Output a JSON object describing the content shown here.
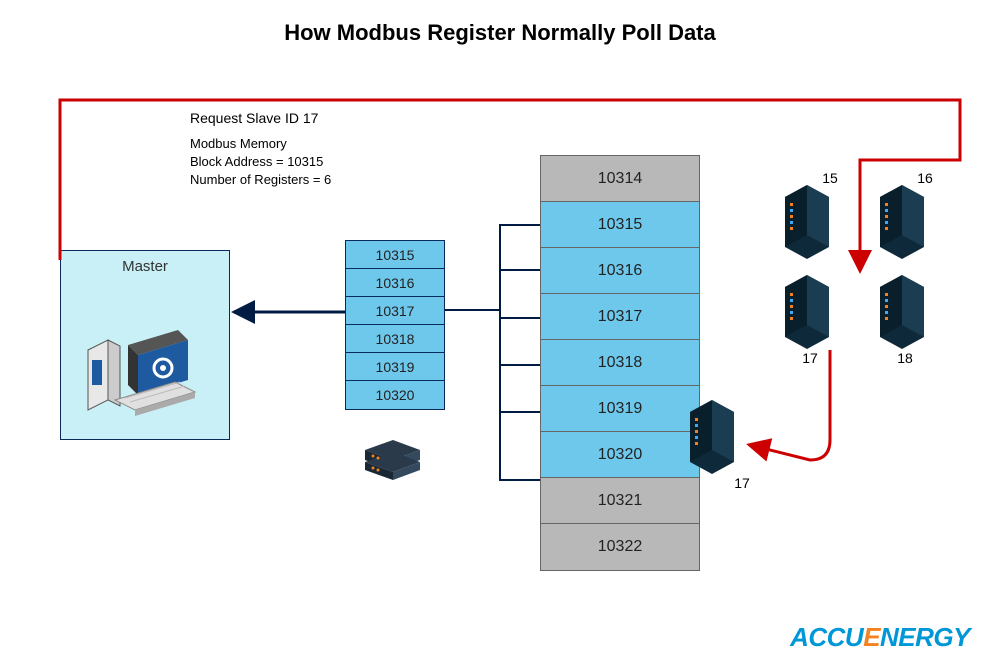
{
  "title": "How Modbus Register Normally Poll Data",
  "request_label": "Request Slave ID 17",
  "memory_info": {
    "line1": "Modbus Memory",
    "line2": "Block Address = 10315",
    "line3": "Number of Registers = 6"
  },
  "master_label": "Master",
  "small_registers": [
    "10315",
    "10316",
    "10317",
    "10318",
    "10319",
    "10320"
  ],
  "large_registers": [
    {
      "val": "10314",
      "gray": true
    },
    {
      "val": "10315",
      "gray": false
    },
    {
      "val": "10316",
      "gray": false
    },
    {
      "val": "10317",
      "gray": false
    },
    {
      "val": "10318",
      "gray": false
    },
    {
      "val": "10319",
      "gray": false
    },
    {
      "val": "10320",
      "gray": false
    },
    {
      "val": "10321",
      "gray": true
    },
    {
      "val": "10322",
      "gray": true
    }
  ],
  "racks": {
    "r15": "15",
    "r16": "16",
    "r17": "17",
    "r18": "18",
    "r17b": "17"
  },
  "logo_text_a": "ACCU",
  "logo_text_b": "E",
  "logo_text_c": "NERGY"
}
